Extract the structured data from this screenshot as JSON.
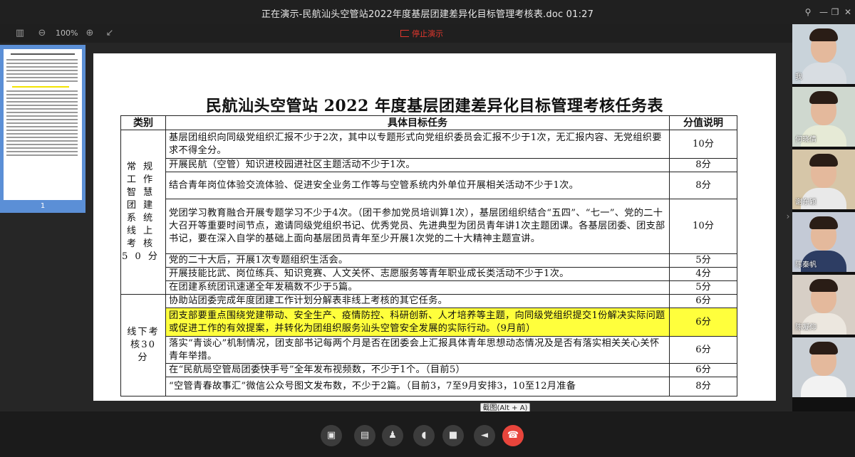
{
  "window": {
    "title": "正在演示-民航汕头空管站2022年度基层团建差异化目标管理考核表.doc 01:27",
    "pin_icon": "pin-icon",
    "minimize_icon": "minimize-icon",
    "restore_icon": "restore-icon",
    "close_icon": "close-icon"
  },
  "toolbar": {
    "zoom_level": "100%",
    "stop_presenting_label": "停止演示"
  },
  "thumbnail": {
    "page_number": "1"
  },
  "document": {
    "title": "民航汕头空管站 2022 年度基层团建差异化目标管理考核任务表",
    "headers": {
      "category": "类别",
      "task": "具体目标任务",
      "score": "分值说明"
    },
    "groups": [
      {
        "category": "常规工作智慧团建系统线上考核50分",
        "rows": [
          {
            "task": "基层团组织向同级党组织汇报不少于2次，其中以专题形式向党组织委员会汇报不少于1次，无汇报内容、无党组织要求不得全分。",
            "score": "10分",
            "highlight": false
          },
          {
            "task": "开展民航（空管）知识进校园进社区主题活动不少于1次。",
            "score": "8分",
            "highlight": false
          },
          {
            "task": "结合青年岗位体验交流体验、促进安全业务工作等与空管系统内外单位开展相关活动不少于1次。",
            "score": "8分",
            "highlight": false
          },
          {
            "task": "党团学习教育融合开展专题学习不少于4次。（团干参加党员培训算1次），基层团组织结合“五四”、“七一”、党的二十大召开等重要时间节点，邀请同级党组织书记、优秀党员、先进典型为团员青年讲1次主题团课。各基层团委、团支部书记，要在深入自学的基础上面向基层团员青年至少开展1次党的二十大精神主题宣讲。",
            "score": "10分",
            "highlight": false
          },
          {
            "task": "党的二十大后，开展1次专题组织生活会。",
            "score": "5分",
            "highlight": false
          },
          {
            "task": "开展技能比武、岗位练兵、知识竞赛、人文关怀、志愿服务等青年职业成长类活动不少于1次。",
            "score": "4分",
            "highlight": false
          },
          {
            "task": "在团建系统团讯速递全年发稿数不少于5篇。",
            "score": "5分",
            "highlight": false
          }
        ]
      },
      {
        "category": "线下考核30分",
        "rows": [
          {
            "task": "协助站团委完成年度团建工作计划分解表非线上考核的其它任务。",
            "score": "6分",
            "highlight": false
          },
          {
            "task": "团支部要重点围绕党建带动、安全生产、疫情防控、科研创新、人才培养等主题，向同级党组织提交1份解决实际问题或促进工作的有效提案，并转化为团组织服务汕头空管安全发展的实际行动。（9月前）",
            "score": "6分",
            "highlight": true
          },
          {
            "task": "落实“青谈心”机制情况，团支部书记每两个月是否在团委会上汇报具体青年思想动态情况及是否有落实相关关心关怀青年举措。",
            "score": "6分",
            "highlight": false
          },
          {
            "task": "在“民航局空管局团委快手号”全年发布视频数，不少于1个。（目前5）",
            "score": "6分",
            "highlight": false
          },
          {
            "task": "“空管青春故事汇”微信公众号图文发布数，不少于2篇。（目前3，7至9月安排3，10至12月准备",
            "score": "8分",
            "highlight": false
          }
        ]
      }
    ]
  },
  "tooltip": {
    "text": "截图(Alt + A)"
  },
  "participants": [
    {
      "name": "我",
      "bg": "#c9d3da",
      "body": "#d8dde2"
    },
    {
      "name": "何晓倩",
      "bg": "#cfd8cf",
      "body": "#e6ead6"
    },
    {
      "name": "谢东颖",
      "bg": "#d6c6a8",
      "body": "#e9e9e9"
    },
    {
      "name": "陈秦帆",
      "bg": "#c4cad6",
      "body": "#2d3d63"
    },
    {
      "name": "陈凝仰",
      "bg": "#d7cfc6",
      "body": "#ece7df"
    },
    {
      "name": "",
      "bg": "#c9cfd5",
      "body": "#f2f2f2"
    }
  ],
  "controls": [
    {
      "name": "share-screen-button",
      "icon": "share-screen-icon",
      "glyph": "▣"
    },
    {
      "name": "share-file-button",
      "icon": "folder-icon",
      "glyph": "▤"
    },
    {
      "name": "add-member-button",
      "icon": "add-user-icon",
      "glyph": "♟"
    },
    {
      "name": "microphone-button",
      "icon": "microphone-icon",
      "glyph": "◖"
    },
    {
      "name": "camera-button",
      "icon": "camera-icon",
      "glyph": "■"
    },
    {
      "name": "speaker-button",
      "icon": "speaker-icon",
      "glyph": "◄"
    },
    {
      "name": "hang-up-button",
      "icon": "hang-up-icon",
      "glyph": "☎"
    }
  ],
  "colors": {
    "highlight": "#ffff3c",
    "stop_red": "#e0372d",
    "hangup_red": "#e8453c",
    "thumb_selected": "#5b8fd6"
  }
}
